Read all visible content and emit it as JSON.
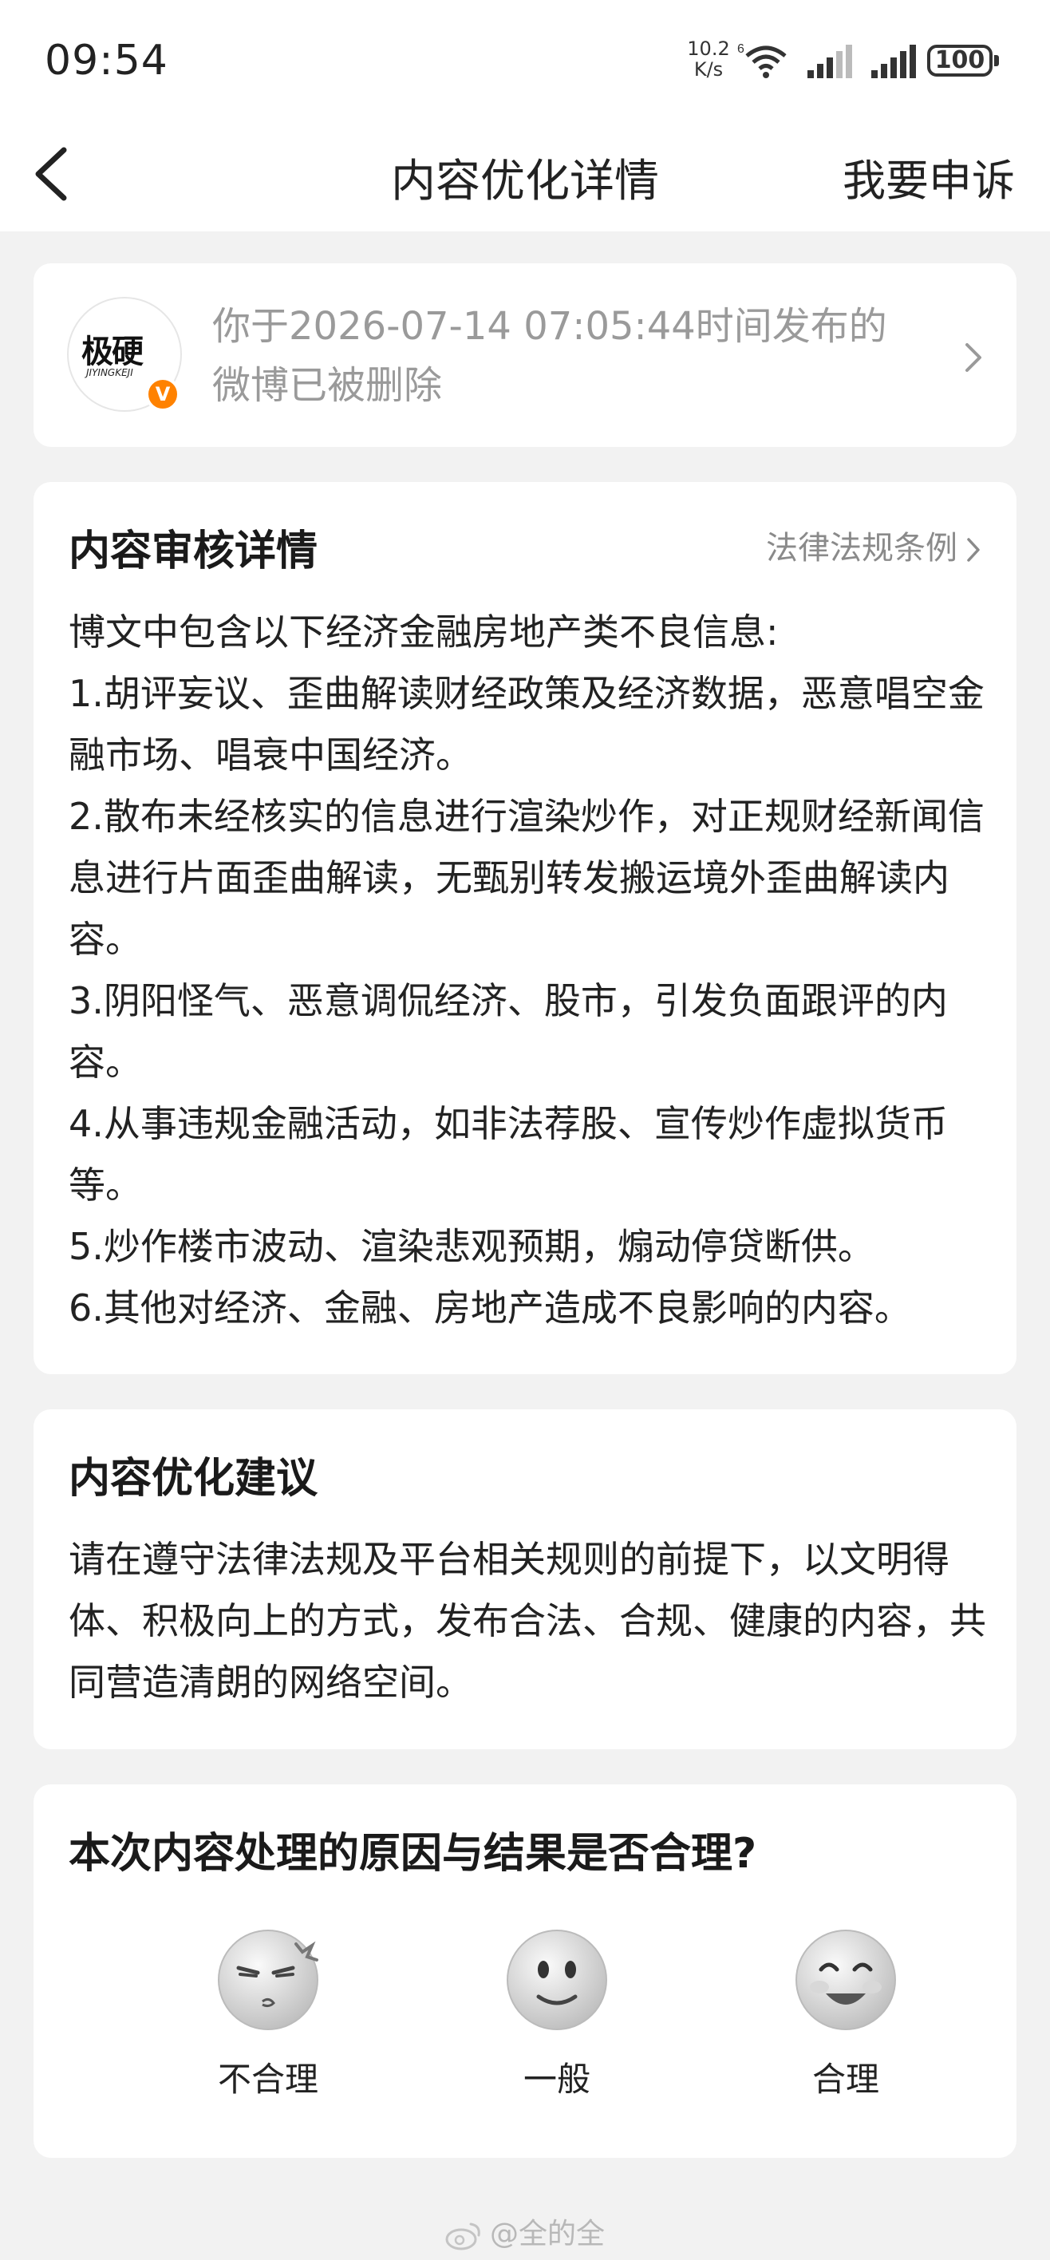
{
  "status_bar": {
    "time": "09:54",
    "net_speed_value": "10.2",
    "net_speed_unit": "K/s",
    "wifi_badge": "6",
    "battery": "100"
  },
  "nav": {
    "title": "内容优化详情",
    "appeal_label": "我要申诉"
  },
  "post": {
    "avatar_text": "极硬",
    "avatar_sub": "JIYINGKEJI",
    "verified": "V",
    "message_line1": "你于2026-07-14 07:05:44时间发布的",
    "message_line2": "微博已被删除"
  },
  "review": {
    "title": "内容审核详情",
    "law_link": "法律法规条例",
    "intro": "博文中包含以下经济金融房地产类不良信息:",
    "items": [
      "1.胡评妄议、歪曲解读财经政策及经济数据，恶意唱空金融市场、唱衰中国经济。",
      "2.散布未经核实的信息进行渲染炒作，对正规财经新闻信息进行片面歪曲解读，无甄别转发搬运境外歪曲解读内容。",
      "3.阴阳怪气、恶意调侃经济、股市，引发负面跟评的内容。",
      "4.从事违规金融活动，如非法荐股、宣传炒作虚拟货币等。",
      "5.炒作楼市波动、渲染悲观预期，煽动停贷断供。",
      "6.其他对经济、金融、房地产造成不良影响的内容。"
    ]
  },
  "suggestion": {
    "title": "内容优化建议",
    "body": "请在遵守法律法规及平台相关规则的前提下，以文明得体、积极向上的方式，发布合法、合规、健康的内容，共同营造清朗的网络空间。"
  },
  "feedback": {
    "question": "本次内容处理的原因与结果是否合理?",
    "options": [
      {
        "label": "不合理",
        "icon": "angry-face-icon"
      },
      {
        "label": "一般",
        "icon": "neutral-face-icon"
      },
      {
        "label": "合理",
        "icon": "happy-face-icon"
      }
    ]
  },
  "watermark": "@全的全",
  "colors": {
    "background": "#f2f2f2",
    "card": "#ffffff",
    "muted_text": "#9a9a9a",
    "verified_orange": "#ff8200"
  }
}
